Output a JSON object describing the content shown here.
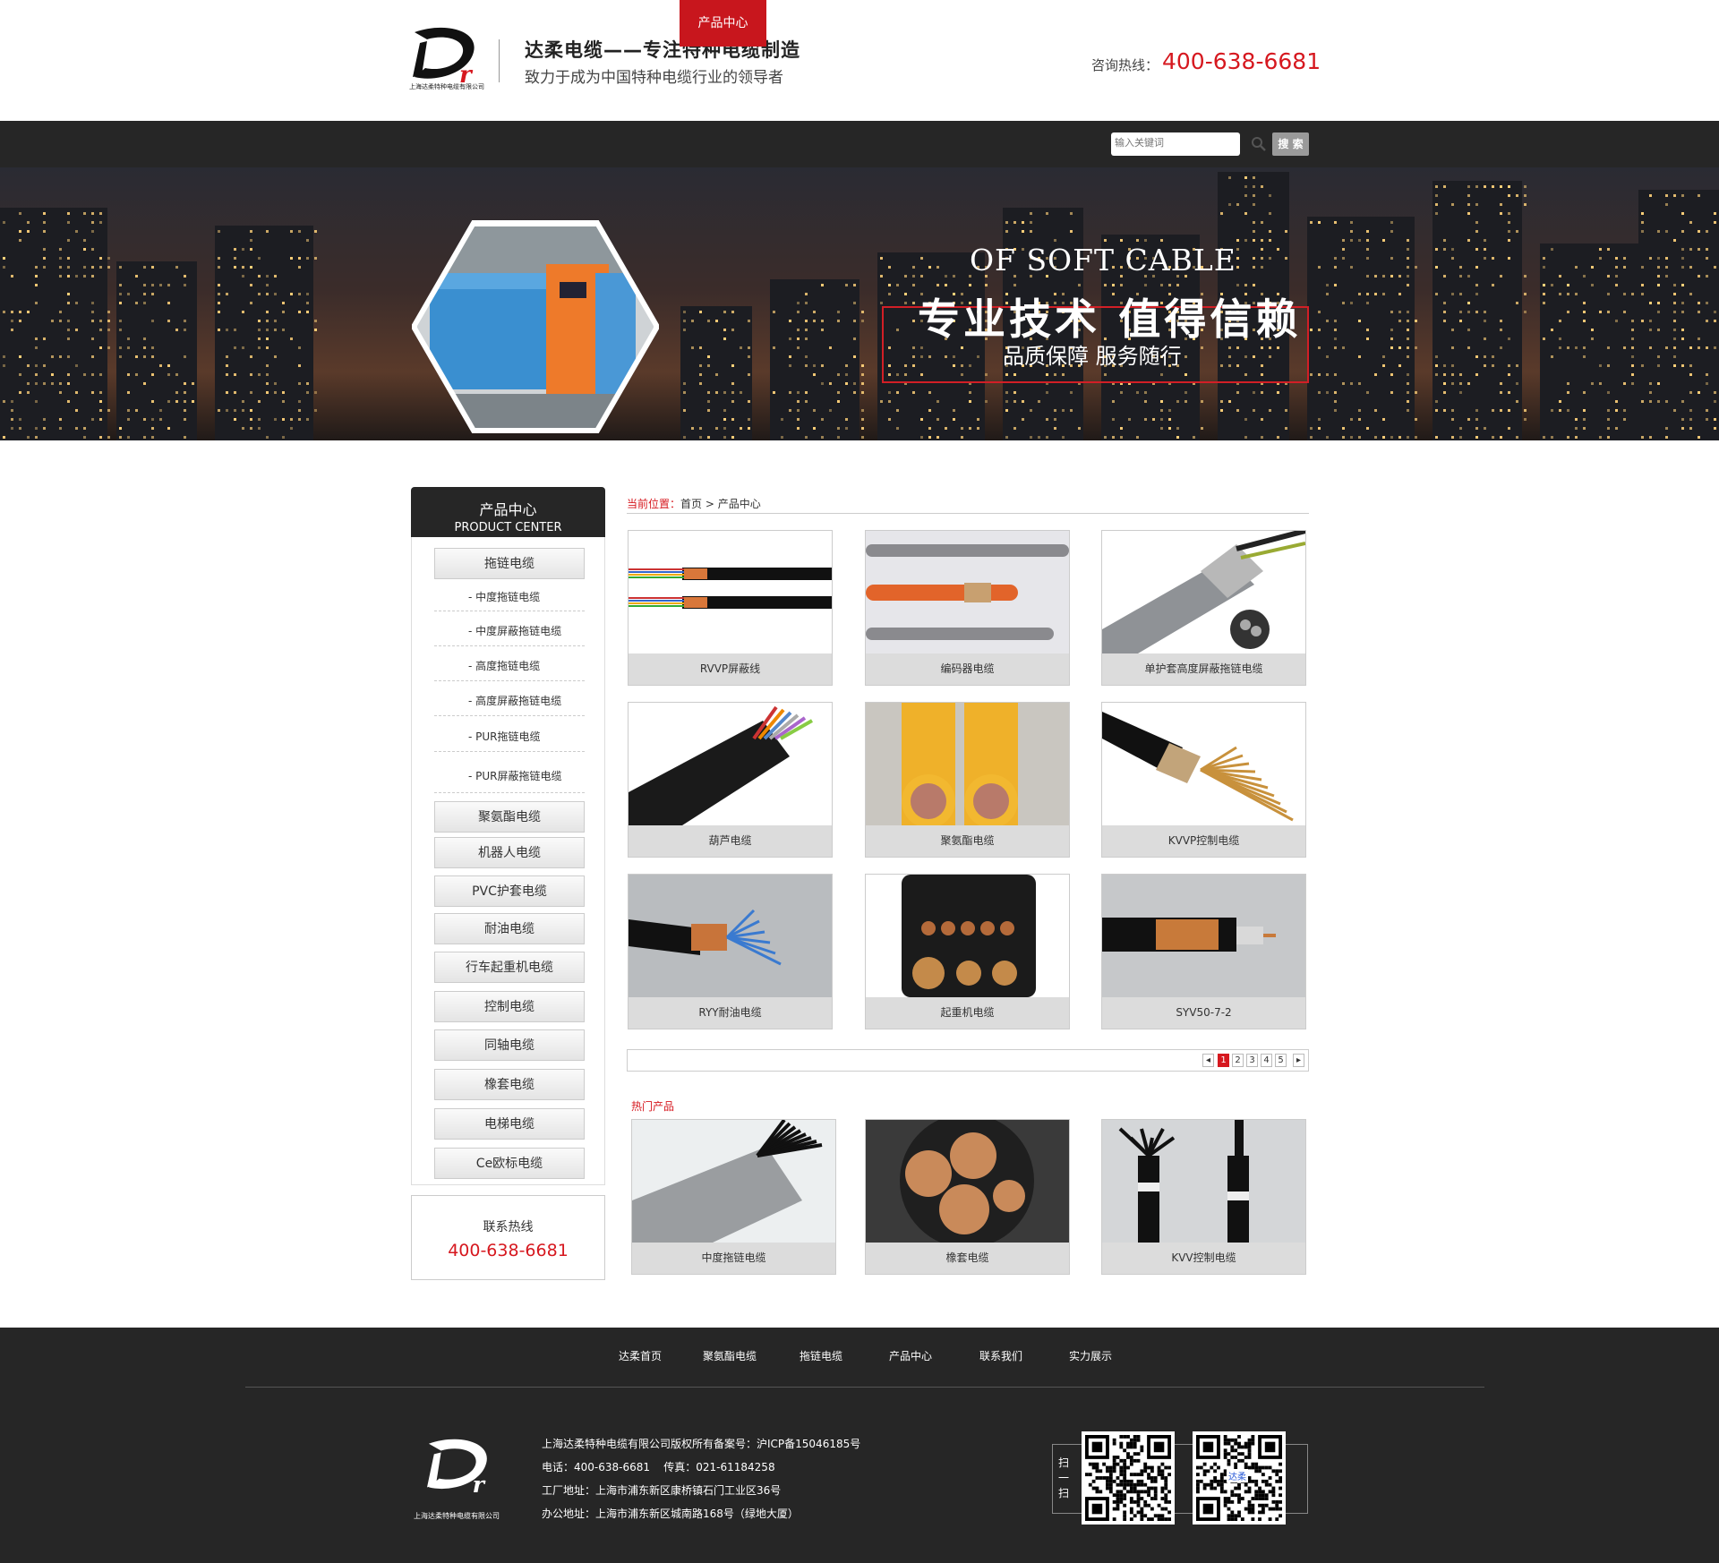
{
  "header": {
    "logo_company": "上海达柔特种电缆有限公司",
    "slogan_main": "达柔电缆——专注特种电缆制造",
    "slogan_sub": "致力于成为中国特种电缆行业的领导者",
    "hotline_label": "咨询热线：",
    "hotline_number": "400-638-6681"
  },
  "nav": {
    "items": [
      {
        "label": "达柔首页",
        "active": false
      },
      {
        "label": "聚氨酯电缆",
        "active": false
      },
      {
        "label": "拖链电缆",
        "active": false
      },
      {
        "label": "产品中心",
        "active": true
      },
      {
        "label": "联系我们",
        "active": false
      },
      {
        "label": "实力展示",
        "active": false
      }
    ],
    "search_placeholder": "输入关键词",
    "search_button": "搜 索"
  },
  "banner": {
    "en_title": "OF SOFT CABLE",
    "cn_title": "专业技术  值得信赖",
    "cn_sub": "品质保障  服务随行"
  },
  "sidebar": {
    "title": "产品中心",
    "title_en": "PRODUCT CENTER",
    "categories": [
      {
        "label": "拖链电缆"
      },
      {
        "label": "- 中度拖链电缆",
        "sub": true
      },
      {
        "label": "- 中度屏蔽拖链电缆",
        "sub": true
      },
      {
        "label": "- 高度拖链电缆",
        "sub": true
      },
      {
        "label": "- 高度屏蔽拖链电缆",
        "sub": true
      },
      {
        "label": "- PUR拖链电缆",
        "sub": true
      },
      {
        "label": "- PUR屏蔽拖链电缆",
        "sub": true
      },
      {
        "label": "聚氨酯电缆"
      },
      {
        "label": "机器人电缆"
      },
      {
        "label": "PVC护套电缆"
      },
      {
        "label": "耐油电缆"
      },
      {
        "label": "行车起重机电缆"
      },
      {
        "label": "控制电缆"
      },
      {
        "label": "同轴电缆"
      },
      {
        "label": "橡套电缆"
      },
      {
        "label": "电梯电缆"
      },
      {
        "label": "Ce欧标电缆"
      }
    ],
    "contact_title": "联系热线",
    "contact_number": "400-638-6681"
  },
  "breadcrumb": {
    "label": "当前位置：",
    "home": "首页",
    "sep": ">",
    "current": "产品中心"
  },
  "products": [
    {
      "name": "RVVP屏蔽线",
      "img": "flat-wires"
    },
    {
      "name": "编码器电缆",
      "img": "orange-grey"
    },
    {
      "name": "单护套高度屏蔽拖链电缆",
      "img": "grey-shield"
    },
    {
      "name": "葫芦电缆",
      "img": "flat-black"
    },
    {
      "name": "聚氨酯电缆",
      "img": "yellow-pur"
    },
    {
      "name": "KVVP控制电缆",
      "img": "black-copper"
    },
    {
      "name": "RYY耐油电缆",
      "img": "black-blue"
    },
    {
      "name": "起重机电缆",
      "img": "flat-crane"
    },
    {
      "name": "SYV50-7-2",
      "img": "coax"
    }
  ],
  "pagination": {
    "prev": "◂",
    "pages": [
      "1",
      "2",
      "3",
      "4",
      "5"
    ],
    "current": "1",
    "next": "▸"
  },
  "hot": {
    "title": "热门产品",
    "items": [
      {
        "name": "中度拖链电缆",
        "img": "grey-bundle"
      },
      {
        "name": "橡套电缆",
        "img": "copper-cores"
      },
      {
        "name": "KVV控制电缆",
        "img": "black-twin"
      }
    ]
  },
  "footer": {
    "nav": [
      "达柔首页",
      "聚氨酯电缆",
      "拖链电缆",
      "产品中心",
      "联系我们",
      "实力展示"
    ],
    "logo_company": "上海达柔特种电缆有限公司",
    "copyright": "上海达柔特种电缆有限公司版权所有备案号：沪ICP备15046185号",
    "phone": "电话：400-638-6681    传真：021-61184258",
    "factory": "工厂地址：上海市浦东新区康桥镇石门工业区36号",
    "office": "办公地址：上海市浦东新区城南路168号（绿地大厦）",
    "scan_label": "扫一扫",
    "qr2_text": "达柔"
  },
  "colors": {
    "accent": "#d6181f",
    "nav_bg": "#262626",
    "nav_active": "#c8161d"
  }
}
